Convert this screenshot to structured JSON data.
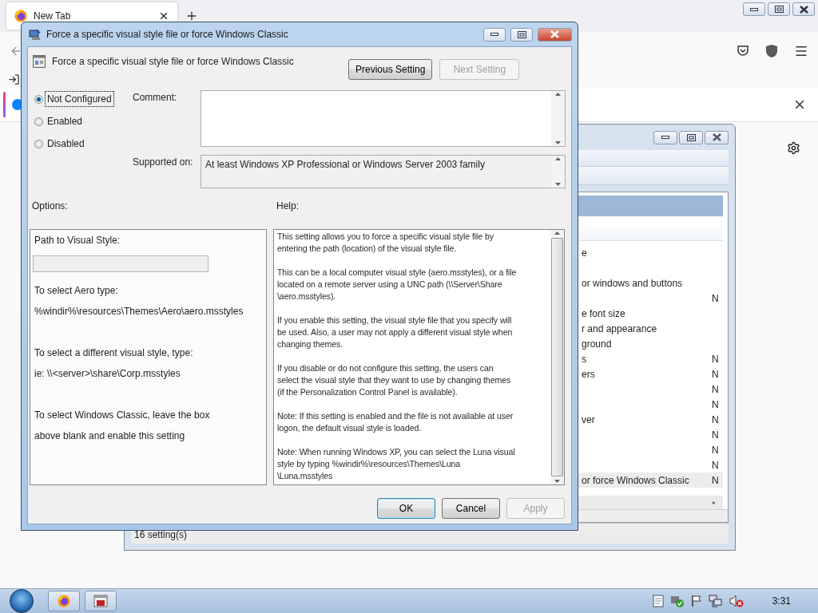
{
  "browser": {
    "tabs": [
      {
        "title": "New Tab",
        "selected": true
      }
    ]
  },
  "policy_window": {
    "rows": [
      {
        "name": "e",
        "selected": false
      },
      {
        "selected": false
      },
      {
        "name": "or windows and buttons",
        "selected": false
      },
      {
        "state": "N",
        "selected": false
      },
      {
        "name": "e font size",
        "selected": false
      },
      {
        "name": "r and appearance",
        "selected": false
      },
      {
        "name": "ground",
        "selected": false
      },
      {
        "name": "s",
        "state": "N",
        "selected": false
      },
      {
        "name": "ers",
        "state": "N",
        "selected": false
      },
      {
        "state": "N",
        "selected": false
      },
      {
        "state": "N",
        "selected": false
      },
      {
        "name": "ver",
        "state": "N",
        "selected": false
      },
      {
        "state": "N",
        "selected": false
      },
      {
        "state": "N",
        "selected": false
      },
      {
        "state": "N",
        "selected": false
      },
      {
        "name": "or force Windows Classic",
        "state": "N",
        "selected": true
      }
    ],
    "status": "16 setting(s)"
  },
  "dialog": {
    "title": "Force a specific visual style file or force Windows Classic",
    "heading": "Force a specific visual style file or force Windows Classic",
    "nav_buttons": [
      {
        "label": "Previous Setting",
        "disabled": false
      },
      {
        "label": "Next Setting",
        "disabled": true
      }
    ],
    "radios": [
      {
        "label": "Not Configured",
        "selected": true
      },
      {
        "label": "Enabled",
        "selected": false
      },
      {
        "label": "Disabled",
        "selected": false
      }
    ],
    "comment_label": "Comment:",
    "supported_label": "Supported on:",
    "supported_value": "At least Windows XP Professional or Windows Server 2003 family",
    "options_label": "Options:",
    "help_label": "Help:",
    "options": [
      {
        "kind": "text",
        "text": "Path to Visual Style:",
        "spaced": false
      },
      {
        "kind": "field",
        "disabled": true
      },
      {
        "kind": "text",
        "text": "To select Aero type:",
        "spaced": false
      },
      {
        "kind": "text",
        "text": "%windir%\\resources\\Themes\\Aero\\aero.msstyles",
        "spaced": false
      },
      {
        "kind": "text",
        "text": "To select a different visual style, type:",
        "spaced": true
      },
      {
        "kind": "text",
        "text": "ie: \\\\<server>\\share\\Corp.msstyles",
        "spaced": false
      },
      {
        "kind": "text",
        "text": "To select Windows Classic, leave the box",
        "spaced": true
      },
      {
        "kind": "text",
        "text": "above blank and enable this setting",
        "spaced": false
      }
    ],
    "help": [
      [
        "This setting allows you to force a specific visual style file by",
        "entering the path (location) of the visual style file."
      ],
      [
        "This can be a local computer visual style (aero.msstyles), or a file",
        "located on a remote server using a UNC path (\\\\Server\\Share",
        "\\aero.msstyles)."
      ],
      [
        "If you enable this setting, the visual style file that you specify will",
        "be used. Also, a user may not apply a different visual style when",
        "changing themes."
      ],
      [
        "If you disable or do not configure this setting, the users can",
        "select the visual style that they want to use by changing themes",
        "(if the Personalization Control Panel is available)."
      ],
      [
        "Note: If this setting is enabled and the file is not available at user",
        "logon, the default visual style is loaded."
      ],
      [
        "Note: When running Windows XP, you can select the Luna visual",
        "style by typing %windir%\\resources\\Themes\\Luna",
        "\\Luna.msstyles"
      ]
    ],
    "buttons": [
      {
        "label": "OK",
        "disabled": false,
        "default": true
      },
      {
        "label": "Cancel",
        "disabled": false,
        "default": false
      },
      {
        "label": "Apply",
        "disabled": true,
        "default": false
      }
    ]
  },
  "taskbar": {
    "clock": "3:31"
  }
}
